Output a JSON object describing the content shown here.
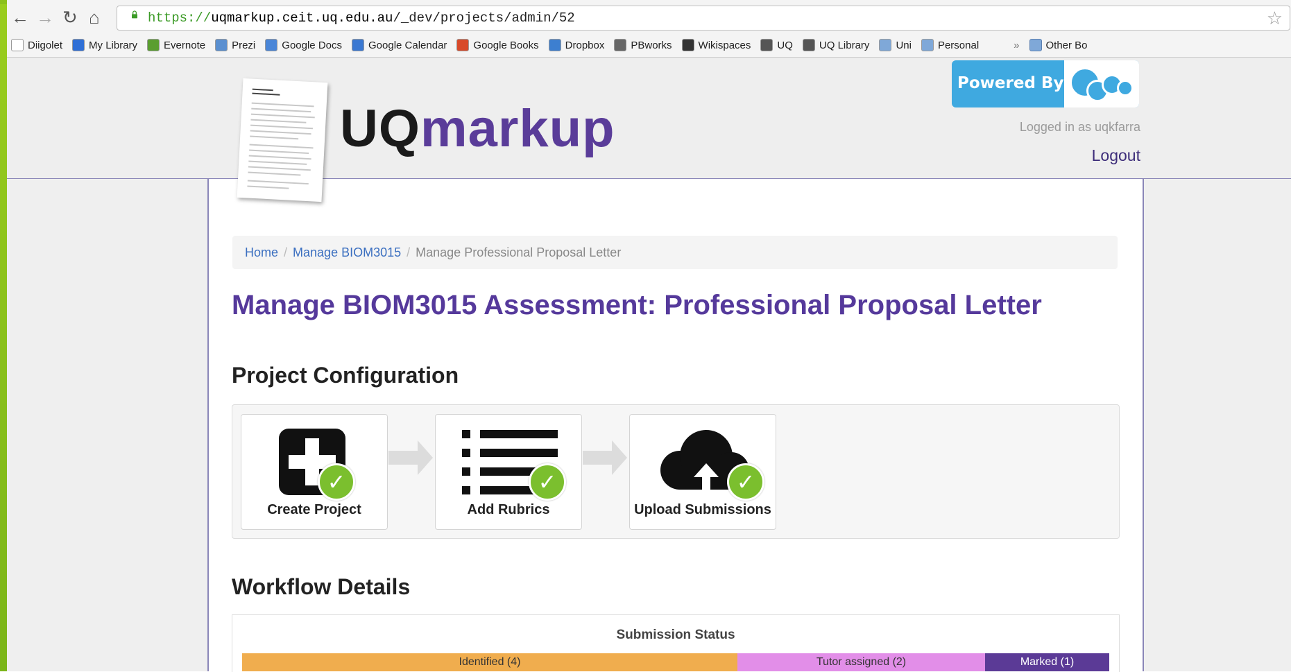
{
  "browser": {
    "url_scheme": "https://",
    "url_host": "uqmarkup.ceit.uq.edu.au",
    "url_path": "/_dev/projects/admin/52",
    "bookmarks": [
      {
        "label": "Diigolet",
        "color": "#ffffff"
      },
      {
        "label": "My Library",
        "color": "#2f6fd6"
      },
      {
        "label": "Evernote",
        "color": "#5a9e2f"
      },
      {
        "label": "Prezi",
        "color": "#5a8fd0"
      },
      {
        "label": "Google Docs",
        "color": "#4a86d8"
      },
      {
        "label": "Google Calendar",
        "color": "#3a78d2"
      },
      {
        "label": "Google Books",
        "color": "#d84a2a"
      },
      {
        "label": "Dropbox",
        "color": "#3d7fd0"
      },
      {
        "label": "PBworks",
        "color": "#666666"
      },
      {
        "label": "Wikispaces",
        "color": "#333333"
      },
      {
        "label": "UQ",
        "color": "#555555"
      },
      {
        "label": "UQ Library",
        "color": "#555555"
      },
      {
        "label": "Uni",
        "color": "#7fa8d8"
      },
      {
        "label": "Personal",
        "color": "#7fa8d8"
      }
    ],
    "overflow_label": "»",
    "other_bookmarks": "Other Bo"
  },
  "header": {
    "brand_uq": "UQ",
    "brand_markup": "markup",
    "powered_by": "Powered By",
    "logged_in": "Logged in as uqkfarra",
    "logout": "Logout"
  },
  "breadcrumb": {
    "home": "Home",
    "course": "Manage BIOM3015",
    "current": "Manage Professional Proposal Letter",
    "sep": "/"
  },
  "main": {
    "title": "Manage BIOM3015 Assessment: Professional Proposal Letter",
    "config_heading": "Project Configuration",
    "steps": [
      {
        "label": "Create Project",
        "status": "complete"
      },
      {
        "label": "Add Rubrics",
        "status": "complete"
      },
      {
        "label": "Upload Submissions",
        "status": "complete"
      }
    ],
    "workflow_heading": "Workflow Details",
    "submission_status": {
      "title": "Submission Status",
      "segments": [
        {
          "label": "Identified (4)",
          "count": 4,
          "color": "#f0ad4e",
          "text_color": "#333333"
        },
        {
          "label": "Tutor assigned (2)",
          "count": 2,
          "color": "#e28ee8",
          "text_color": "#333333"
        },
        {
          "label": "Marked (1)",
          "count": 1,
          "color": "#5b3a96",
          "text_color": "#ffffff"
        }
      ]
    }
  }
}
